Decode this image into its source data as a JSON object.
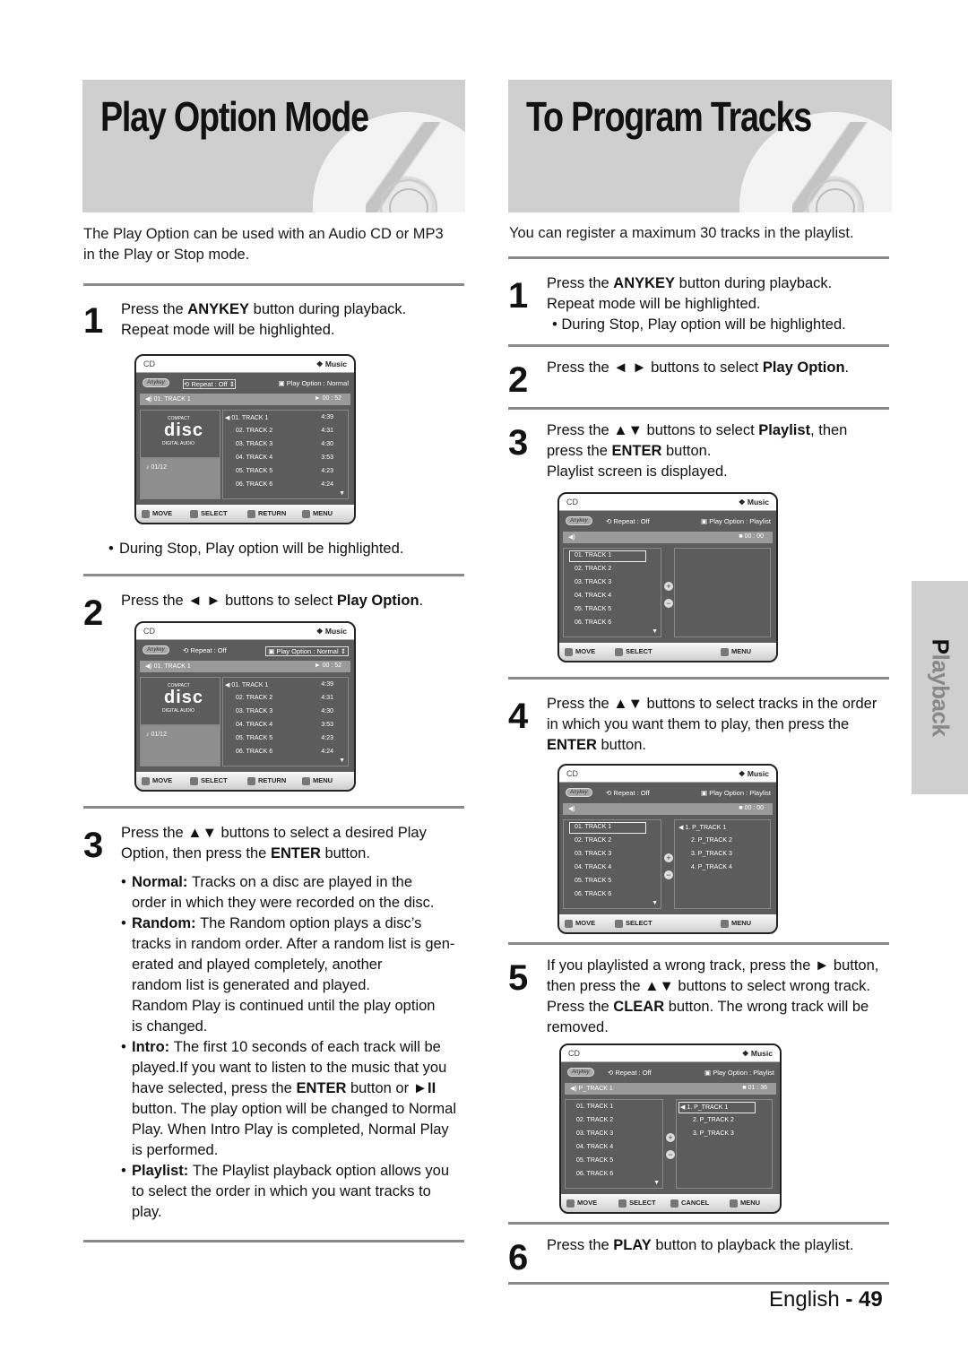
{
  "left": {
    "title": "Play Option Mode",
    "intro": [
      "The Play Option can be used with an Audio CD or MP3",
      "in the Play or Stop mode."
    ],
    "steps": [
      {
        "num": "1",
        "lines": [
          "Press the |ANYKEY| button during playback.",
          "Repeat mode will be highlighted."
        ]
      },
      {
        "num": "2",
        "lines": [
          "Press the ◄ ► buttons to select |Play Option|."
        ]
      },
      {
        "num": "3",
        "lines": [
          "Press the ▲▼ buttons to select a desired Play",
          "Option, then press the |ENTER| button."
        ]
      }
    ],
    "note_after_step1": "During Stop, Play option will be highlighted.",
    "options": [
      {
        "term": "Normal:",
        "lines": [
          "Tracks on a disc are played in the",
          "order in which they were recorded on the disc."
        ]
      },
      {
        "term": "Random:",
        "lines": [
          "The Random option plays a disc’s",
          "tracks in random order. After a random list is gen-",
          "erated and played completely, another",
          "random list is generated and played.",
          "Random Play is continued until the play option",
          "is changed."
        ]
      },
      {
        "term": "Intro:",
        "lines": [
          "The first 10 seconds of each track will be",
          "played.If you want to listen to the music that you",
          "have selected, press the |ENTER| button or |►II|",
          "button. The play option will be changed to Normal",
          "Play. When Intro Play is completed, Normal Play",
          "is performed."
        ]
      },
      {
        "term": "Playlist:",
        "lines": [
          "The Playlist playback option allows you",
          "to select the order in which you want tracks to",
          "play."
        ]
      }
    ]
  },
  "right": {
    "title": "To Program Tracks",
    "intro": "You can register a maximum 30 tracks in the playlist.",
    "steps": [
      {
        "num": "1",
        "lines": [
          "Press the |ANYKEY| button during playback.",
          "Repeat mode will be highlighted."
        ],
        "note": "During Stop, Play option will be highlighted."
      },
      {
        "num": "2",
        "lines": [
          "Press the ◄ ► buttons to select |Play Option|."
        ]
      },
      {
        "num": "3",
        "lines": [
          "Press the ▲▼ buttons to select |Playlist|, then",
          "press the |ENTER| button.",
          "Playlist screen is displayed."
        ]
      },
      {
        "num": "4",
        "lines": [
          "Press the ▲▼ buttons to select tracks in the order",
          "in which you want them to play, then press the",
          "|ENTER| button."
        ]
      },
      {
        "num": "5",
        "lines": [
          "If you playlisted a wrong track, press the ► button,",
          "then press the ▲▼ buttons to select wrong track.",
          "Press the |CLEAR| button. The wrong track will be",
          "removed."
        ]
      },
      {
        "num": "6",
        "lines": [
          "Press the |PLAY| button to playback the playlist."
        ]
      }
    ]
  },
  "osd": {
    "source": "CD",
    "mode": "❖ Music",
    "anykey": "Anykey",
    "repeat": "Repeat : Off",
    "tracks": [
      "01. TRACK 1",
      "02. TRACK 2",
      "03. TRACK 3",
      "04. TRACK 4",
      "05. TRACK 5",
      "06. TRACK 6"
    ],
    "durations": [
      "4:39",
      "4:31",
      "4:30",
      "3:53",
      "4:23",
      "4:24"
    ],
    "disc_counter": "01/12",
    "logo_top": "COMPACT",
    "logo_main": "disc",
    "logo_bottom": "DIGITAL AUDIO",
    "normal": {
      "play_option": "Play Option : Normal",
      "now_playing": "01. TRACK 1",
      "time": "00 : 52"
    },
    "playlist": {
      "play_option": "Play Option : Playlist",
      "time_stopped": "00 : 00"
    },
    "programmed": [
      "1. P_TRACK 1",
      "2. P_TRACK 2",
      "3. P_TRACK 3",
      "4. P_TRACK 4"
    ],
    "after_clear": {
      "now_playing": "P_TRACK 1",
      "time": "01 : 36",
      "list": [
        "1. P_TRACK 1",
        "2. P_TRACK 2",
        "3. P_TRACK 3"
      ]
    },
    "buttons": {
      "move": "MOVE",
      "select": "SELECT",
      "return": "RETURN",
      "menu": "MENU",
      "cancel": "CANCEL"
    }
  },
  "side_tab": "Playback",
  "footer": {
    "lang": "English",
    "sep": " - ",
    "page": "49"
  }
}
